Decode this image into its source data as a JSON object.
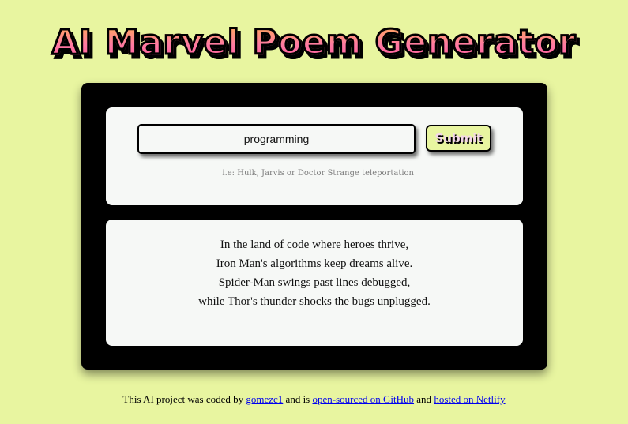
{
  "header": {
    "title": "AI Marvel Poem Generator"
  },
  "form": {
    "query_value": "programming",
    "submit_label": "Submit",
    "hint": "i.e: Hulk, Jarvis or Doctor Strange teleportation"
  },
  "poem": {
    "lines": [
      "In the land of code where heroes thrive,",
      "Iron Man's algorithms keep dreams alive.",
      "Spider-Man swings past lines debugged,",
      "while Thor's thunder shocks the bugs unplugged."
    ]
  },
  "footer": {
    "text_1": "This AI project was coded by ",
    "author_link": "gomezc1",
    "text_2": " and is ",
    "github_link": "open-sourced on GitHub",
    "text_3": " and ",
    "netlify_link": "hosted on Netlify"
  },
  "colors": {
    "background": "#e8f5a0",
    "card": "#000000",
    "panel": "#f6f8f6",
    "title_gradient_top": "#ffb347",
    "title_gradient_bottom": "#ff4f9a",
    "link": "#0000ee"
  }
}
